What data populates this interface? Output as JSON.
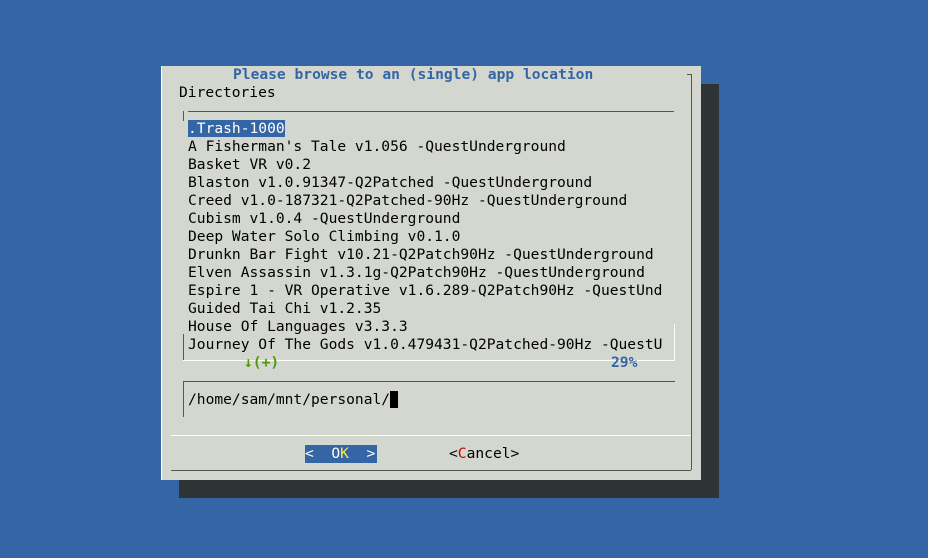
{
  "dialog": {
    "title": "Please browse to an (single) app location",
    "directories_label": "Directories",
    "items": [
      ".Trash-1000",
      "A Fisherman's Tale v1.056 -QuestUnderground",
      "Basket VR v0.2",
      "Blaston v1.0.91347-Q2Patched -QuestUnderground",
      "Creed v1.0-187321-Q2Patched-90Hz -QuestUnderground",
      "Cubism v1.0.4 -QuestUnderground",
      "Deep Water Solo Climbing v0.1.0",
      "Drunkn Bar Fight v10.21-Q2Patch90Hz -QuestUnderground",
      "Elven Assassin v1.3.1g-Q2Patch90Hz -QuestUnderground",
      "Espire 1 - VR Operative v1.6.289-Q2Patch90Hz -QuestUnd",
      "Guided Tai Chi v1.2.35",
      "House Of Languages v3.3.3",
      "Journey Of The Gods v1.0.479431-Q2Patched-90Hz -QuestU"
    ],
    "selected_index": 0,
    "scroll_indicator": "↓(+)",
    "scroll_percent": "29%",
    "path_value": "/home/sam/mnt/personal/",
    "ok_button": {
      "left": "<  O",
      "hot": "K",
      "right": "  >"
    },
    "cancel_button": {
      "left": "<",
      "hot": "C",
      "right": "ancel>"
    }
  },
  "colors": {
    "background": "#3465a4",
    "dialog": "#d3d7cf",
    "shadow": "#2e3436",
    "title": "#3465a4",
    "scroll_indicator": "#4e9a06",
    "hotkey_ok": "#fce94f",
    "hotkey_cancel": "#cc0000"
  }
}
